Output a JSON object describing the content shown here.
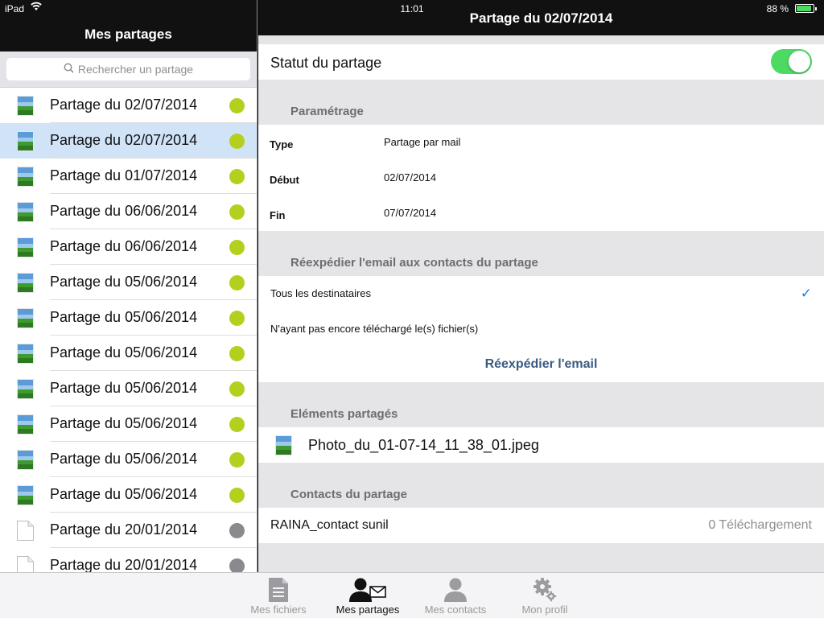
{
  "status_bar": {
    "device": "iPad",
    "time": "11:01",
    "battery": "88 %"
  },
  "left": {
    "title": "Mes partages",
    "search_placeholder": "Rechercher un partage",
    "items": [
      {
        "label": "Partage du 02/07/2014",
        "thumb": "image",
        "status": "active"
      },
      {
        "label": "Partage du 02/07/2014",
        "thumb": "image",
        "status": "active",
        "selected": true
      },
      {
        "label": "Partage du 01/07/2014",
        "thumb": "image",
        "status": "active"
      },
      {
        "label": "Partage du 06/06/2014",
        "thumb": "image",
        "status": "active"
      },
      {
        "label": "Partage du 06/06/2014",
        "thumb": "image",
        "status": "active"
      },
      {
        "label": "Partage du 05/06/2014",
        "thumb": "image",
        "status": "active"
      },
      {
        "label": "Partage du 05/06/2014",
        "thumb": "image",
        "status": "active"
      },
      {
        "label": "Partage du 05/06/2014",
        "thumb": "image",
        "status": "active"
      },
      {
        "label": "Partage du 05/06/2014",
        "thumb": "image",
        "status": "active"
      },
      {
        "label": "Partage du 05/06/2014",
        "thumb": "image",
        "status": "active"
      },
      {
        "label": "Partage du 05/06/2014",
        "thumb": "image",
        "status": "active"
      },
      {
        "label": "Partage du 05/06/2014",
        "thumb": "image",
        "status": "active"
      },
      {
        "label": "Partage du 20/01/2014",
        "thumb": "document",
        "status": "inactive"
      },
      {
        "label": "Partage du 20/01/2014",
        "thumb": "document",
        "status": "inactive"
      }
    ]
  },
  "right": {
    "title": "Partage du 02/07/2014",
    "status_label": "Statut du partage",
    "status_on": true,
    "param_section": "Paramétrage",
    "params": [
      {
        "key": "Type",
        "value": "Partage par mail"
      },
      {
        "key": "Début",
        "value": "02/07/2014"
      },
      {
        "key": "Fin",
        "value": "07/07/2014"
      }
    ],
    "resend_section": "Réexpédier l'email aux contacts du partage",
    "resend_options": [
      {
        "label": "Tous les destinataires",
        "checked": true
      },
      {
        "label": "N'ayant pas encore téléchargé le(s) fichier(s)",
        "checked": false
      }
    ],
    "resend_button": "Réexpédier l'email",
    "shared_section": "Eléments partagés",
    "shared_file": "Photo_du_01-07-14_11_38_01.jpeg",
    "contacts_section": "Contacts du partage",
    "contact_name": "RAINA_contact sunil",
    "contact_downloads": "0 Téléchargement"
  },
  "tabs": [
    {
      "label": "Mes fichiers",
      "icon": "document-icon",
      "active": false
    },
    {
      "label": "Mes partages",
      "icon": "share-contact-icon",
      "active": true
    },
    {
      "label": "Mes contacts",
      "icon": "person-icon",
      "active": false
    },
    {
      "label": "Mon profil",
      "icon": "gear-icon",
      "active": false
    }
  ],
  "colors": {
    "active_dot": "#b5cf1e",
    "inactive_dot": "#8a8a8e",
    "toggle_on": "#4cd964",
    "selected_row": "#d0e3f7",
    "accent_check": "#1a7fe0"
  }
}
